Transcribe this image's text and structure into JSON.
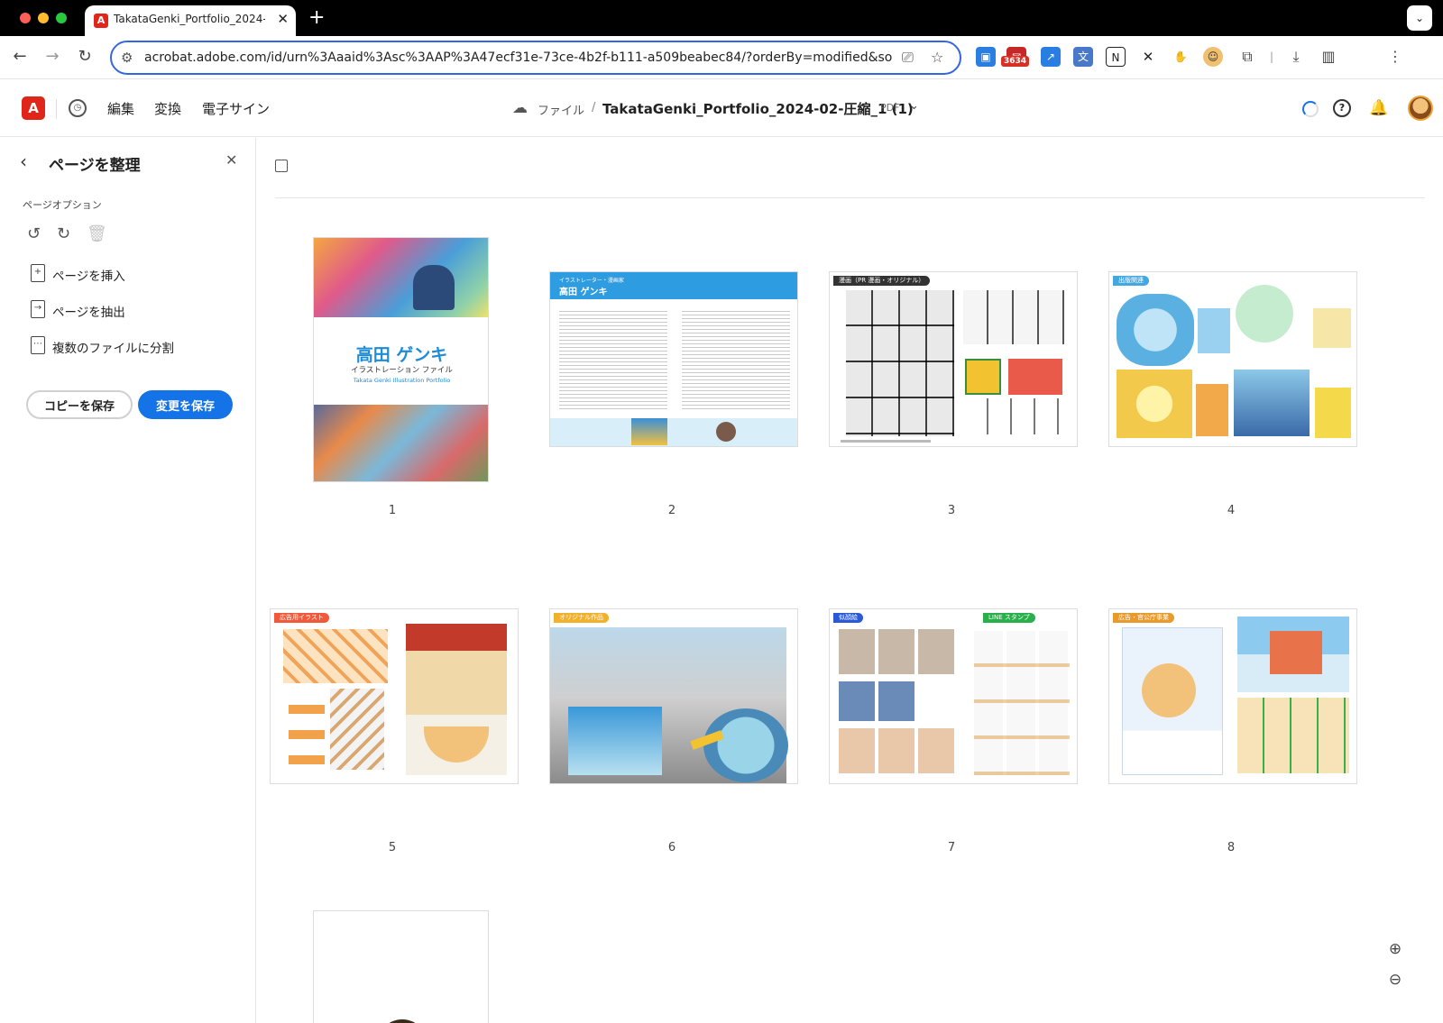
{
  "browser": {
    "tab_title": "TakataGenki_Portfolio_2024-",
    "url": "acrobat.adobe.com/id/urn%3Aaaid%3Asc%3AAP%3A47ecf31e-73ce-4b2f-b111-a509beabec84/?orderBy=modified&sortO...",
    "extension_badge": "3634"
  },
  "header": {
    "tabs": [
      "編集",
      "変換",
      "電子サイン"
    ],
    "breadcrumb_files": "ファイル",
    "breadcrumb_sep": "/",
    "document_title": "TakataGenki_Portfolio_2024-02-圧縮_1 (1)",
    "document_type": "PDF"
  },
  "left_panel": {
    "title": "ページを整理",
    "section_label": "ページオプション",
    "items": [
      {
        "label": "ページを挿入"
      },
      {
        "label": "ページを抽出"
      },
      {
        "label": "複数のファイルに分割"
      }
    ],
    "copy_save_label": "コピーを保存",
    "save_changes_label": "変更を保存"
  },
  "pages": [
    {
      "number": "1",
      "title_jp": "高田 ゲンキ",
      "subtitle_jp": "イラストレーション ファイル",
      "subtitle_en": "Takata Genki Illustration Portfolio"
    },
    {
      "number": "2",
      "tag": "イラストレーター・漫画家",
      "name": "高田 ゲンキ"
    },
    {
      "number": "3",
      "tag": "漫画（PR 漫画・オリジナル）"
    },
    {
      "number": "4",
      "tag": "出版関連"
    },
    {
      "number": "5",
      "tag": "広告用イラスト"
    },
    {
      "number": "6",
      "tag": "オリジナル作品"
    },
    {
      "number": "7",
      "tag": "似顔絵",
      "tag2": "LINE スタンプ"
    },
    {
      "number": "8",
      "tag": "広告・官公庁事業"
    }
  ],
  "colors": {
    "accent": "#1473e6",
    "acrobat_red": "#e0251b"
  }
}
